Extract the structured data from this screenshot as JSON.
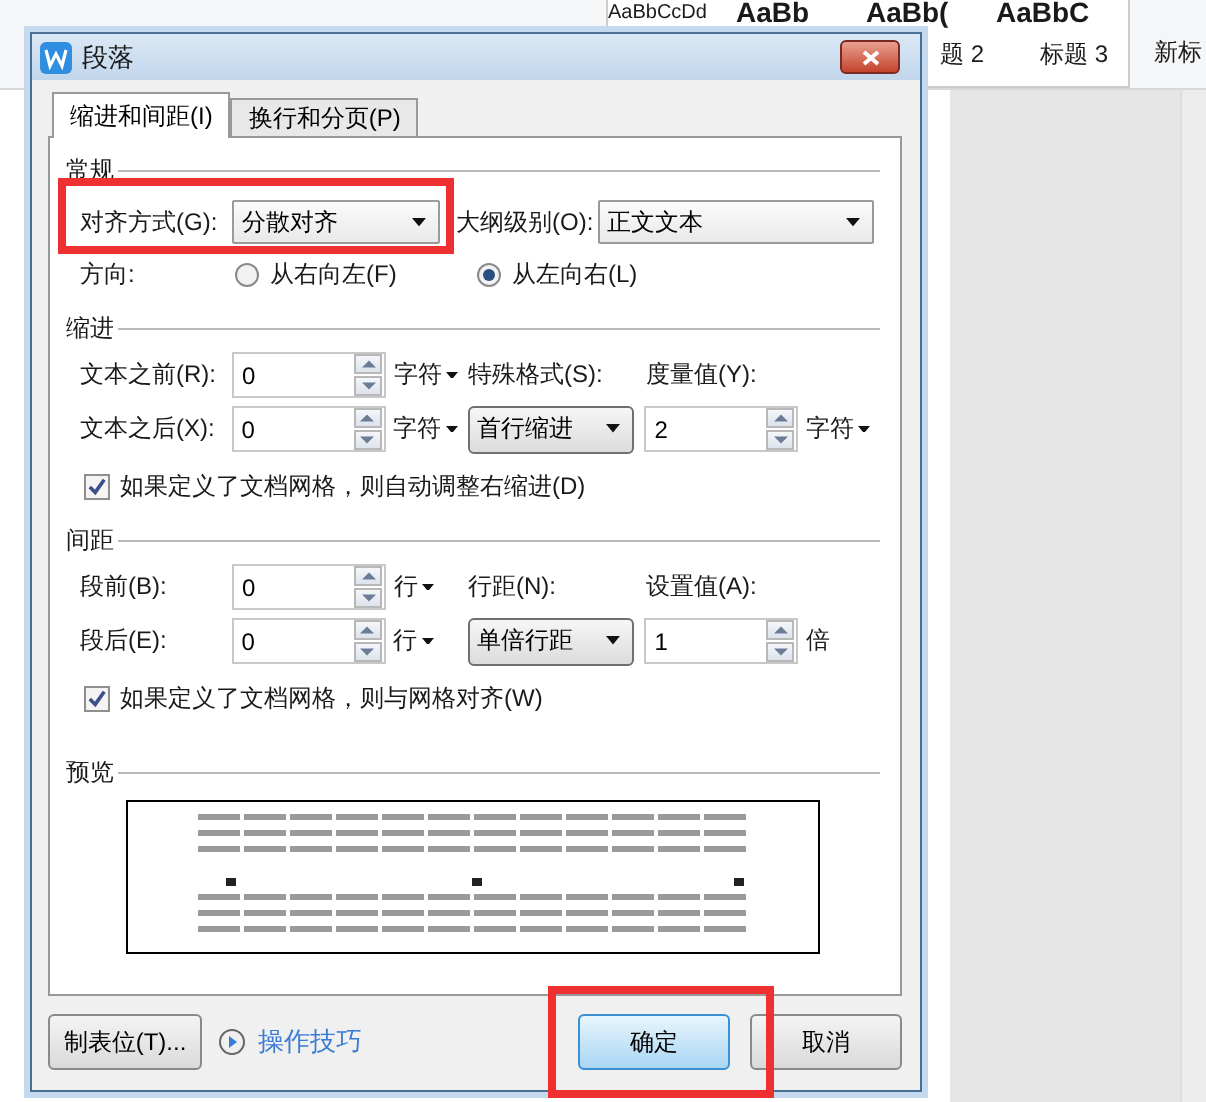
{
  "background": {
    "styles": [
      {
        "preview": "AaBbCcDd",
        "kind": "small"
      },
      {
        "preview": "AaBb",
        "kind": "big"
      },
      {
        "preview": "AaBb(",
        "kind": "big"
      },
      {
        "preview": "AaBbC",
        "kind": "big"
      }
    ],
    "style_labels": [
      "题 2",
      "标题 3"
    ],
    "new_style": "新标"
  },
  "window": {
    "title": "段落"
  },
  "tabs": [
    {
      "label": "缩进和间距(I)",
      "selected": true
    },
    {
      "label": "换行和分页(P)",
      "selected": false
    }
  ],
  "general": {
    "title": "常规",
    "alignment": {
      "label": "对齐方式(G):",
      "value": "分散对齐",
      "highlighted": true
    },
    "outline": {
      "label": "大纲级别(O):",
      "value": "正文文本"
    },
    "direction": {
      "label": "方向:",
      "options": [
        {
          "label": "从右向左(F)",
          "selected": false
        },
        {
          "label": "从左向右(L)",
          "selected": true
        }
      ]
    }
  },
  "indent": {
    "title": "缩进",
    "rows": [
      {
        "label": "文本之前(R):",
        "value": "0",
        "unit": "字符",
        "head3": "特殊格式(S):",
        "head4": "度量值(Y):"
      },
      {
        "label": "文本之后(X):",
        "value": "0",
        "unit": "字符",
        "select": "首行缩进",
        "value2": "2",
        "unit2": "字符"
      }
    ],
    "checkbox": {
      "label": "如果定义了文档网格，则自动调整右缩进(D)",
      "checked": true
    }
  },
  "spacing": {
    "title": "间距",
    "rows": [
      {
        "label": "段前(B):",
        "value": "0",
        "unit": "行",
        "head3": "行距(N):",
        "head4": "设置值(A):"
      },
      {
        "label": "段后(E):",
        "value": "0",
        "unit": "行",
        "select": "单倍行距",
        "value2": "1",
        "unit2": "倍"
      }
    ],
    "checkbox": {
      "label": "如果定义了文档网格，则与网格对齐(W)",
      "checked": true
    }
  },
  "preview": {
    "title": "预览"
  },
  "buttons": {
    "tabs": "制表位(T)...",
    "tips": "操作技巧",
    "ok": {
      "label": "确定",
      "highlighted": true
    },
    "cancel": "取消"
  }
}
